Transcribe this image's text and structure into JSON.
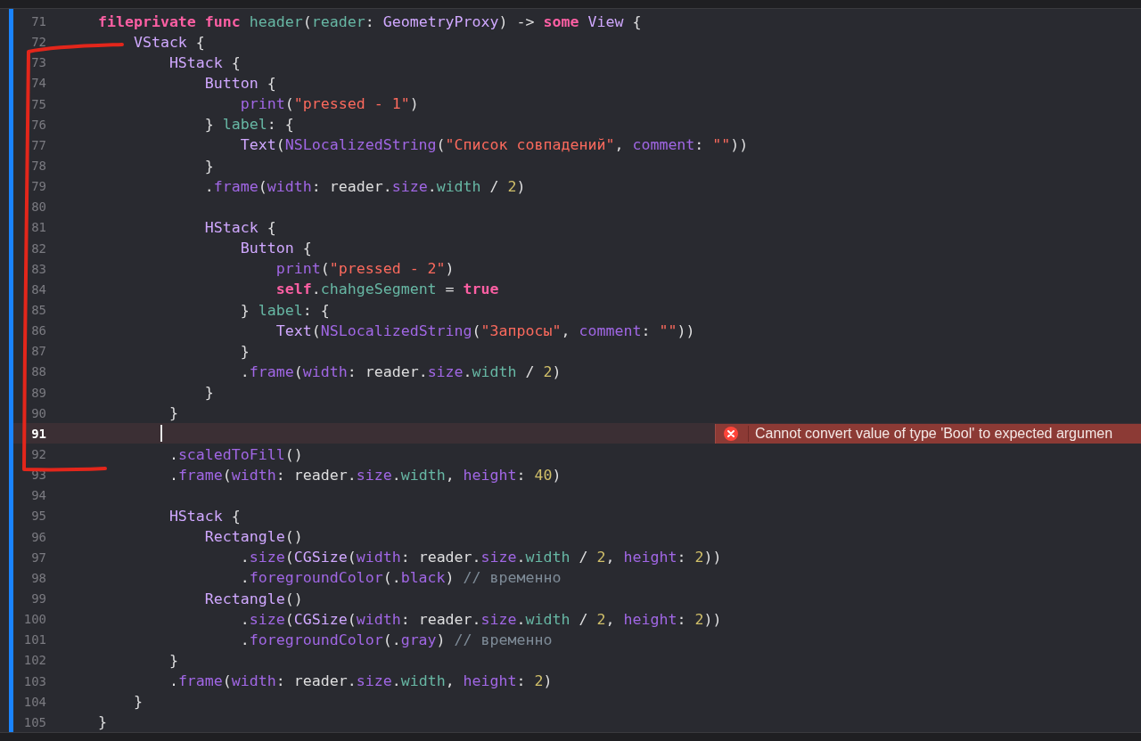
{
  "editor": {
    "lines": [
      {
        "number": "71",
        "current": false,
        "tokens": [
          {
            "text": "    fileprivate func",
            "kind": "keyword"
          },
          {
            "text": " header",
            "kind": "ident"
          },
          {
            "text": "(",
            "kind": "plain"
          },
          {
            "text": "reader",
            "kind": "ident"
          },
          {
            "text": ": ",
            "kind": "plain"
          },
          {
            "text": "GeometryProxy",
            "kind": "type"
          },
          {
            "text": ") -> ",
            "kind": "plain"
          },
          {
            "text": "some",
            "kind": "keyword"
          },
          {
            "text": " View",
            "kind": "type"
          },
          {
            "text": " {",
            "kind": "plain"
          }
        ]
      },
      {
        "number": "72",
        "current": false,
        "tokens": [
          {
            "text": "        VStack",
            "kind": "type"
          },
          {
            "text": " {",
            "kind": "plain"
          }
        ]
      },
      {
        "number": "73",
        "current": false,
        "tokens": [
          {
            "text": "            HStack",
            "kind": "type"
          },
          {
            "text": " {",
            "kind": "plain"
          }
        ]
      },
      {
        "number": "74",
        "current": false,
        "tokens": [
          {
            "text": "                Button",
            "kind": "type"
          },
          {
            "text": " {",
            "kind": "plain"
          }
        ]
      },
      {
        "number": "75",
        "current": false,
        "tokens": [
          {
            "text": "                    print",
            "kind": "method"
          },
          {
            "text": "(",
            "kind": "plain"
          },
          {
            "text": "\"pressed - 1\"",
            "kind": "string"
          },
          {
            "text": ")",
            "kind": "plain"
          }
        ]
      },
      {
        "number": "76",
        "current": false,
        "tokens": [
          {
            "text": "                } ",
            "kind": "plain"
          },
          {
            "text": "label",
            "kind": "ident"
          },
          {
            "text": ": {",
            "kind": "plain"
          }
        ]
      },
      {
        "number": "77",
        "current": false,
        "tokens": [
          {
            "text": "                    Text",
            "kind": "type"
          },
          {
            "text": "(",
            "kind": "plain"
          },
          {
            "text": "NSLocalizedString",
            "kind": "method"
          },
          {
            "text": "(",
            "kind": "plain"
          },
          {
            "text": "\"Список совпадений\"",
            "kind": "string"
          },
          {
            "text": ", ",
            "kind": "plain"
          },
          {
            "text": "comment",
            "kind": "method"
          },
          {
            "text": ": ",
            "kind": "plain"
          },
          {
            "text": "\"\"",
            "kind": "string"
          },
          {
            "text": "))",
            "kind": "plain"
          }
        ]
      },
      {
        "number": "78",
        "current": false,
        "tokens": [
          {
            "text": "                }",
            "kind": "plain"
          }
        ]
      },
      {
        "number": "79",
        "current": false,
        "tokens": [
          {
            "text": "                .",
            "kind": "plain"
          },
          {
            "text": "frame",
            "kind": "method"
          },
          {
            "text": "(",
            "kind": "plain"
          },
          {
            "text": "width",
            "kind": "method"
          },
          {
            "text": ": reader.",
            "kind": "plain"
          },
          {
            "text": "size",
            "kind": "method"
          },
          {
            "text": ".",
            "kind": "plain"
          },
          {
            "text": "width",
            "kind": "ident"
          },
          {
            "text": " / ",
            "kind": "plain"
          },
          {
            "text": "2",
            "kind": "number"
          },
          {
            "text": ")",
            "kind": "plain"
          }
        ]
      },
      {
        "number": "80",
        "current": false
      },
      {
        "number": "81",
        "current": false,
        "tokens": [
          {
            "text": "                HStack",
            "kind": "type"
          },
          {
            "text": " {",
            "kind": "plain"
          }
        ]
      },
      {
        "number": "82",
        "current": false,
        "tokens": [
          {
            "text": "                    Button",
            "kind": "type"
          },
          {
            "text": " {",
            "kind": "plain"
          }
        ]
      },
      {
        "number": "83",
        "current": false,
        "tokens": [
          {
            "text": "                        print",
            "kind": "method"
          },
          {
            "text": "(",
            "kind": "plain"
          },
          {
            "text": "\"pressed - 2\"",
            "kind": "string"
          },
          {
            "text": ")",
            "kind": "plain"
          }
        ]
      },
      {
        "number": "84",
        "current": false,
        "tokens": [
          {
            "text": "                        self",
            "kind": "keyword"
          },
          {
            "text": ".",
            "kind": "plain"
          },
          {
            "text": "chahgeSegment",
            "kind": "ident"
          },
          {
            "text": " = ",
            "kind": "plain"
          },
          {
            "text": "true",
            "kind": "keyword"
          }
        ]
      },
      {
        "number": "85",
        "current": false,
        "tokens": [
          {
            "text": "                    } ",
            "kind": "plain"
          },
          {
            "text": "label",
            "kind": "ident"
          },
          {
            "text": ": {",
            "kind": "plain"
          }
        ]
      },
      {
        "number": "86",
        "current": false,
        "tokens": [
          {
            "text": "                        Text",
            "kind": "type"
          },
          {
            "text": "(",
            "kind": "plain"
          },
          {
            "text": "NSLocalizedString",
            "kind": "method"
          },
          {
            "text": "(",
            "kind": "plain"
          },
          {
            "text": "\"Запросы\"",
            "kind": "string"
          },
          {
            "text": ", ",
            "kind": "plain"
          },
          {
            "text": "comment",
            "kind": "method"
          },
          {
            "text": ": ",
            "kind": "plain"
          },
          {
            "text": "\"\"",
            "kind": "string"
          },
          {
            "text": "))",
            "kind": "plain"
          }
        ]
      },
      {
        "number": "87",
        "current": false,
        "tokens": [
          {
            "text": "                    }",
            "kind": "plain"
          }
        ]
      },
      {
        "number": "88",
        "current": false,
        "tokens": [
          {
            "text": "                    .",
            "kind": "plain"
          },
          {
            "text": "frame",
            "kind": "method"
          },
          {
            "text": "(",
            "kind": "plain"
          },
          {
            "text": "width",
            "kind": "method"
          },
          {
            "text": ": reader.",
            "kind": "plain"
          },
          {
            "text": "size",
            "kind": "method"
          },
          {
            "text": ".",
            "kind": "plain"
          },
          {
            "text": "width",
            "kind": "ident"
          },
          {
            "text": " / ",
            "kind": "plain"
          },
          {
            "text": "2",
            "kind": "number"
          },
          {
            "text": ")",
            "kind": "plain"
          }
        ]
      },
      {
        "number": "89",
        "current": false,
        "tokens": [
          {
            "text": "                }",
            "kind": "plain"
          }
        ]
      },
      {
        "number": "90",
        "current": false,
        "tokens": [
          {
            "text": "            }",
            "kind": "plain"
          }
        ]
      },
      {
        "number": "91",
        "current": true,
        "error": "Cannot convert value of type 'Bool' to expected argumen"
      },
      {
        "number": "92",
        "current": false,
        "tokens": [
          {
            "text": "            .",
            "kind": "plain"
          },
          {
            "text": "scaledToFill",
            "kind": "method"
          },
          {
            "text": "()",
            "kind": "plain"
          }
        ]
      },
      {
        "number": "93",
        "current": false,
        "tokens": [
          {
            "text": "            .",
            "kind": "plain"
          },
          {
            "text": "frame",
            "kind": "method"
          },
          {
            "text": "(",
            "kind": "plain"
          },
          {
            "text": "width",
            "kind": "method"
          },
          {
            "text": ": reader.",
            "kind": "plain"
          },
          {
            "text": "size",
            "kind": "method"
          },
          {
            "text": ".",
            "kind": "plain"
          },
          {
            "text": "width",
            "kind": "ident"
          },
          {
            "text": ", ",
            "kind": "plain"
          },
          {
            "text": "height",
            "kind": "method"
          },
          {
            "text": ": ",
            "kind": "plain"
          },
          {
            "text": "40",
            "kind": "number"
          },
          {
            "text": ")",
            "kind": "plain"
          }
        ]
      },
      {
        "number": "94",
        "current": false
      },
      {
        "number": "95",
        "current": false,
        "tokens": [
          {
            "text": "            HStack",
            "kind": "type"
          },
          {
            "text": " {",
            "kind": "plain"
          }
        ]
      },
      {
        "number": "96",
        "current": false,
        "tokens": [
          {
            "text": "                Rectangle",
            "kind": "type"
          },
          {
            "text": "()",
            "kind": "plain"
          }
        ]
      },
      {
        "number": "97",
        "current": false,
        "tokens": [
          {
            "text": "                    .",
            "kind": "plain"
          },
          {
            "text": "size",
            "kind": "method"
          },
          {
            "text": "(",
            "kind": "plain"
          },
          {
            "text": "CGSize",
            "kind": "type"
          },
          {
            "text": "(",
            "kind": "plain"
          },
          {
            "text": "width",
            "kind": "method"
          },
          {
            "text": ": reader.",
            "kind": "plain"
          },
          {
            "text": "size",
            "kind": "method"
          },
          {
            "text": ".",
            "kind": "plain"
          },
          {
            "text": "width",
            "kind": "ident"
          },
          {
            "text": " / ",
            "kind": "plain"
          },
          {
            "text": "2",
            "kind": "number"
          },
          {
            "text": ", ",
            "kind": "plain"
          },
          {
            "text": "height",
            "kind": "method"
          },
          {
            "text": ": ",
            "kind": "plain"
          },
          {
            "text": "2",
            "kind": "number"
          },
          {
            "text": "))",
            "kind": "plain"
          }
        ]
      },
      {
        "number": "98",
        "current": false,
        "tokens": [
          {
            "text": "                    .",
            "kind": "plain"
          },
          {
            "text": "foregroundColor",
            "kind": "method"
          },
          {
            "text": "(.",
            "kind": "plain"
          },
          {
            "text": "black",
            "kind": "method"
          },
          {
            "text": ") ",
            "kind": "plain"
          },
          {
            "text": "// временно",
            "kind": "comment"
          }
        ]
      },
      {
        "number": "99",
        "current": false,
        "tokens": [
          {
            "text": "                Rectangle",
            "kind": "type"
          },
          {
            "text": "()",
            "kind": "plain"
          }
        ]
      },
      {
        "number": "100",
        "current": false,
        "tokens": [
          {
            "text": "                    .",
            "kind": "plain"
          },
          {
            "text": "size",
            "kind": "method"
          },
          {
            "text": "(",
            "kind": "plain"
          },
          {
            "text": "CGSize",
            "kind": "type"
          },
          {
            "text": "(",
            "kind": "plain"
          },
          {
            "text": "width",
            "kind": "method"
          },
          {
            "text": ": reader.",
            "kind": "plain"
          },
          {
            "text": "size",
            "kind": "method"
          },
          {
            "text": ".",
            "kind": "plain"
          },
          {
            "text": "width",
            "kind": "ident"
          },
          {
            "text": " / ",
            "kind": "plain"
          },
          {
            "text": "2",
            "kind": "number"
          },
          {
            "text": ", ",
            "kind": "plain"
          },
          {
            "text": "height",
            "kind": "method"
          },
          {
            "text": ": ",
            "kind": "plain"
          },
          {
            "text": "2",
            "kind": "number"
          },
          {
            "text": "))",
            "kind": "plain"
          }
        ]
      },
      {
        "number": "101",
        "current": false,
        "tokens": [
          {
            "text": "                    .",
            "kind": "plain"
          },
          {
            "text": "foregroundColor",
            "kind": "method"
          },
          {
            "text": "(.",
            "kind": "plain"
          },
          {
            "text": "gray",
            "kind": "method"
          },
          {
            "text": ") ",
            "kind": "plain"
          },
          {
            "text": "// временно",
            "kind": "comment"
          }
        ]
      },
      {
        "number": "102",
        "current": false,
        "tokens": [
          {
            "text": "            }",
            "kind": "plain"
          }
        ]
      },
      {
        "number": "103",
        "current": false,
        "tokens": [
          {
            "text": "            .",
            "kind": "plain"
          },
          {
            "text": "frame",
            "kind": "method"
          },
          {
            "text": "(",
            "kind": "plain"
          },
          {
            "text": "width",
            "kind": "method"
          },
          {
            "text": ": reader.",
            "kind": "plain"
          },
          {
            "text": "size",
            "kind": "method"
          },
          {
            "text": ".",
            "kind": "plain"
          },
          {
            "text": "width",
            "kind": "ident"
          },
          {
            "text": ", ",
            "kind": "plain"
          },
          {
            "text": "height",
            "kind": "method"
          },
          {
            "text": ": ",
            "kind": "plain"
          },
          {
            "text": "2",
            "kind": "number"
          },
          {
            "text": ")",
            "kind": "plain"
          }
        ]
      },
      {
        "number": "104",
        "current": false,
        "tokens": [
          {
            "text": "        }",
            "kind": "plain"
          }
        ]
      },
      {
        "number": "105",
        "current": false,
        "tokens": [
          {
            "text": "    }",
            "kind": "plain"
          }
        ]
      }
    ]
  }
}
